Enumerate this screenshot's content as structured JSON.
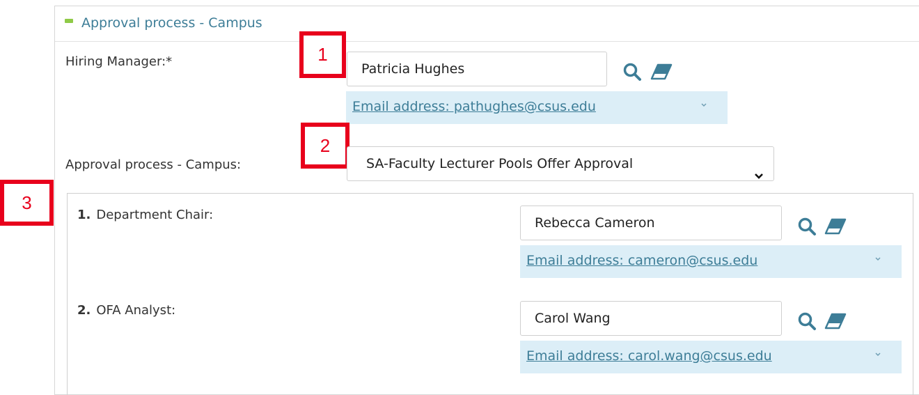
{
  "section": {
    "title": "Approval process - Campus"
  },
  "hiring_manager": {
    "label": "Hiring Manager:*",
    "value": "Patricia Hughes",
    "email_text": "Email address: pathughes@csus.edu"
  },
  "approval_process": {
    "label": "Approval process - Campus:",
    "selected": "SA-Faculty Lecturer Pools Offer Approval"
  },
  "approvers": [
    {
      "number": "1.",
      "role": "Department Chair:",
      "value": "Rebecca Cameron",
      "email_text": "Email address: cameron@csus.edu"
    },
    {
      "number": "2.",
      "role": "OFA Analyst:",
      "value": "Carol Wang",
      "email_text": "Email address: carol.wang@csus.edu"
    }
  ],
  "callouts": [
    "1",
    "2",
    "3"
  ],
  "icons": {
    "search": "search-icon",
    "clear": "eraser-icon",
    "expand": "chevron-down-icon"
  },
  "colors": {
    "accent": "#3d7d97",
    "email_bg": "#dceef7",
    "callout": "#e8001c",
    "collapse": "#8fca47"
  }
}
